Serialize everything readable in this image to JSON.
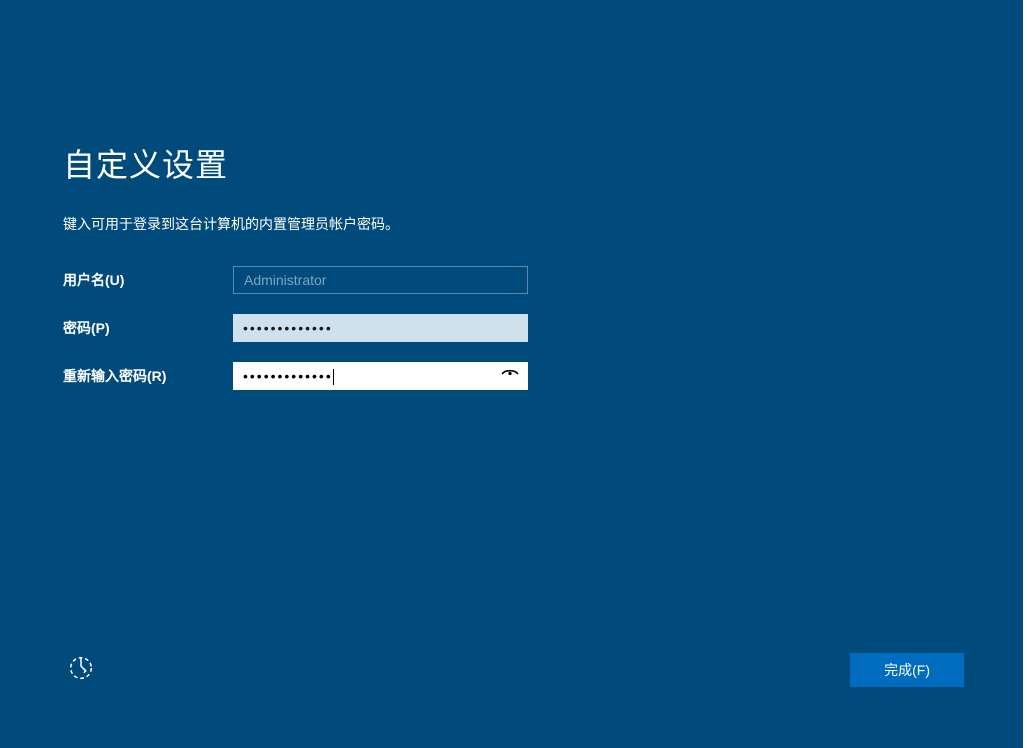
{
  "page": {
    "title": "自定义设置",
    "subtitle": "键入可用于登录到这台计算机的内置管理员帐户密码。"
  },
  "form": {
    "username_label": "用户名(U)",
    "username_value": "Administrator",
    "password_label": "密码(P)",
    "password_mask": "•••••••••••••",
    "confirm_label": "重新输入密码(R)",
    "confirm_mask": "•••••••••••••"
  },
  "footer": {
    "finish_label": "完成(F)"
  }
}
